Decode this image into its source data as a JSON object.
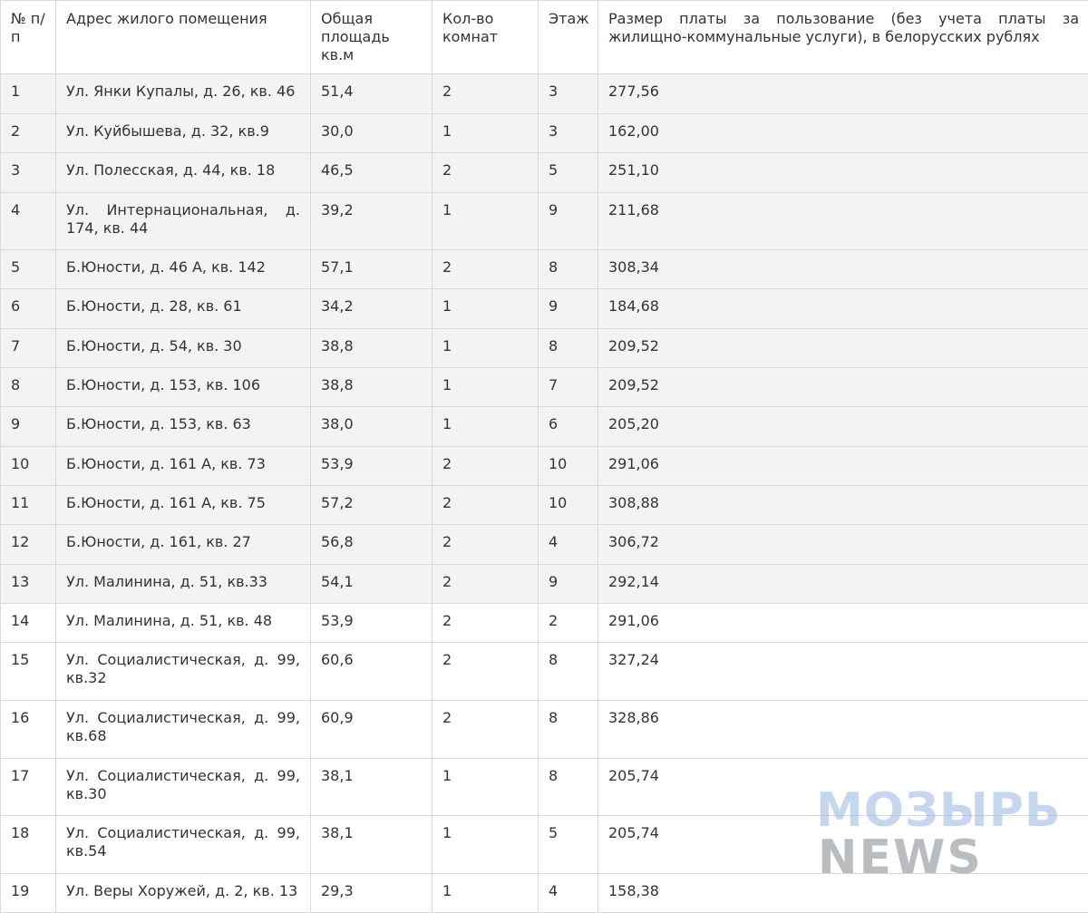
{
  "table": {
    "headers": {
      "num": "№ п/п",
      "address": "Адрес жилого помещения",
      "area": "Общая площадь кв.м",
      "rooms": "Кол-во комнат",
      "floor": "Этаж",
      "fee": "Размер платы за пользование (без учета платы за жилищно-коммунальные услуги), в белорусских рублях"
    },
    "rows": [
      {
        "num": "1",
        "address": "Ул. Янки Купалы, д. 26, кв. 46",
        "area": "51,4",
        "rooms": "2",
        "floor": "3",
        "fee": "277,56"
      },
      {
        "num": "2",
        "address": "Ул. Куйбышева, д. 32, кв.9",
        "area": "30,0",
        "rooms": "1",
        "floor": "3",
        "fee": "162,00"
      },
      {
        "num": "3",
        "address": "Ул. Полесская, д. 44, кв. 18",
        "area": "46,5",
        "rooms": "2",
        "floor": "5",
        "fee": "251,10"
      },
      {
        "num": "4",
        "address": "Ул. Интернациональная, д. 174, кв. 44",
        "area": "39,2",
        "rooms": "1",
        "floor": "9",
        "fee": "211,68"
      },
      {
        "num": "5",
        "address": "Б.Юности, д. 46 А, кв. 142",
        "area": "57,1",
        "rooms": "2",
        "floor": "8",
        "fee": "308,34"
      },
      {
        "num": "6",
        "address": "Б.Юности, д. 28, кв. 61",
        "area": "34,2",
        "rooms": "1",
        "floor": "9",
        "fee": "184,68"
      },
      {
        "num": "7",
        "address": "Б.Юности, д. 54, кв. 30",
        "area": "38,8",
        "rooms": "1",
        "floor": "8",
        "fee": "209,52"
      },
      {
        "num": "8",
        "address": "Б.Юности, д. 153, кв. 106",
        "area": "38,8",
        "rooms": "1",
        "floor": "7",
        "fee": "209,52"
      },
      {
        "num": "9",
        "address": "Б.Юности, д. 153, кв. 63",
        "area": "38,0",
        "rooms": "1",
        "floor": "6",
        "fee": "205,20"
      },
      {
        "num": "10",
        "address": "Б.Юности, д. 161 А, кв. 73",
        "area": "53,9",
        "rooms": "2",
        "floor": "10",
        "fee": "291,06"
      },
      {
        "num": "11",
        "address": "Б.Юности, д. 161 А, кв. 75",
        "area": "57,2",
        "rooms": "2",
        "floor": "10",
        "fee": "308,88"
      },
      {
        "num": "12",
        "address": "Б.Юности, д. 161, кв. 27",
        "area": "56,8",
        "rooms": "2",
        "floor": "4",
        "fee": "306,72"
      },
      {
        "num": "13",
        "address": "Ул. Малинина, д. 51, кв.33",
        "area": "54,1",
        "rooms": "2",
        "floor": "9",
        "fee": "292,14"
      },
      {
        "num": "14",
        "address": "Ул. Малинина, д. 51, кв. 48",
        "area": "53,9",
        "rooms": "2",
        "floor": "2",
        "fee": "291,06"
      },
      {
        "num": "15",
        "address": "Ул. Социалистическая, д. 99, кв.32",
        "area": "60,6",
        "rooms": "2",
        "floor": "8",
        "fee": "327,24"
      },
      {
        "num": "16",
        "address": "Ул. Социалистическая, д. 99, кв.68",
        "area": "60,9",
        "rooms": "2",
        "floor": "8",
        "fee": "328,86"
      },
      {
        "num": "17",
        "address": "Ул. Социалистическая, д. 99, кв.30",
        "area": "38,1",
        "rooms": "1",
        "floor": "8",
        "fee": "205,74"
      },
      {
        "num": "18",
        "address": "Ул. Социалистическая, д. 99, кв.54",
        "area": "38,1",
        "rooms": "1",
        "floor": "5",
        "fee": "205,74"
      },
      {
        "num": "19",
        "address": "Ул. Веры Хоружей, д. 2, кв. 13",
        "area": "29,3",
        "rooms": "1",
        "floor": "4",
        "fee": "158,38"
      }
    ]
  },
  "watermark": {
    "line1": "МОЗЫРЬ",
    "line2": "NEWS"
  }
}
